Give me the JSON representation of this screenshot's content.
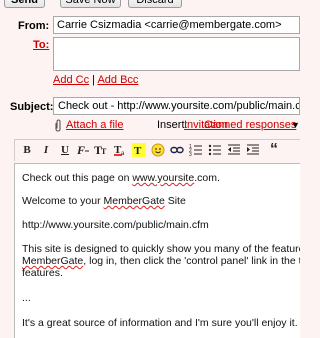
{
  "toolbar": {
    "send": "Send",
    "save_now": "Save Now",
    "discard": "Discard"
  },
  "from": {
    "label": "From:",
    "value": "Carrie Csizmadia <carrie@membergate.com>"
  },
  "to": {
    "label": "To:",
    "value": ""
  },
  "add_cc": "Add Cc",
  "separator": "|",
  "add_bcc": "Add Bcc",
  "subject": {
    "label": "Subject:",
    "value": "Check out - http://www.yoursite.com/public/main.cfm"
  },
  "attach": {
    "attach_file": "Attach a file",
    "insert_label": "Insert:",
    "invitation": "Invitation",
    "canned": "Canned responses",
    "canned_arrow": "▼"
  },
  "format_icons": [
    "bold-icon",
    "italic-icon",
    "underline-icon",
    "font-icon",
    "font-size-icon",
    "text-color-icon",
    "highlight-color-icon",
    "emoticon-icon",
    "link-icon",
    "numbered-list-icon",
    "bulleted-list-icon",
    "indent-less-icon",
    "indent-more-icon",
    "quote-icon"
  ],
  "body": {
    "line1": "Check out this page on ",
    "line1_link": "www.yoursite",
    "line1_end": ".com.",
    "line2_start": "Welcome to your ",
    "line2_brand": "MemberGate",
    "line2_end": " Site",
    "line3": "http://www.yoursite.com/public/main.cfm",
    "line4": "This site is designed to quickly show you many of the features",
    "line5_brand": "MemberGate",
    "line5_end": ", log in, then click the 'control panel' link in the top",
    "line6": "features.",
    "line7": "...",
    "line8": "It's a great source of information and I'm sure you'll enjoy it."
  }
}
